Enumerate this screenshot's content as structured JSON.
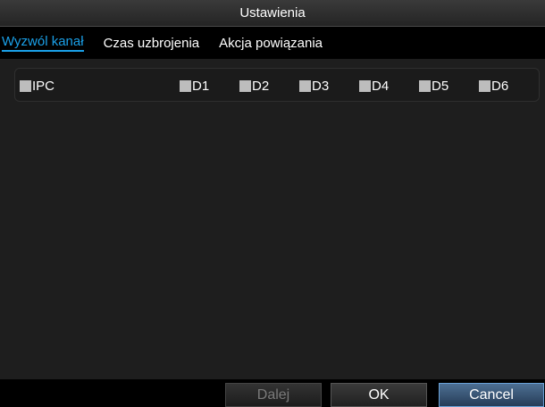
{
  "window": {
    "title": "Ustawienia"
  },
  "tabs": [
    {
      "label": "Wyzwól kanał",
      "active": true
    },
    {
      "label": "Czas uzbrojenia",
      "active": false
    },
    {
      "label": "Akcja powiązania",
      "active": false
    }
  ],
  "channels": {
    "ipc": {
      "label": "IPC",
      "checked": false
    },
    "items": [
      {
        "label": "D1",
        "checked": false
      },
      {
        "label": "D2",
        "checked": false
      },
      {
        "label": "D3",
        "checked": false
      },
      {
        "label": "D4",
        "checked": false
      },
      {
        "label": "D5",
        "checked": false
      },
      {
        "label": "D6",
        "checked": false
      }
    ]
  },
  "buttons": {
    "next_label": "Dalej",
    "ok_label": "OK",
    "cancel_label": "Cancel"
  },
  "colors": {
    "accent": "#1aa0e8",
    "checkbox": "#bdbdbd",
    "panel": "#1e1e1e"
  }
}
